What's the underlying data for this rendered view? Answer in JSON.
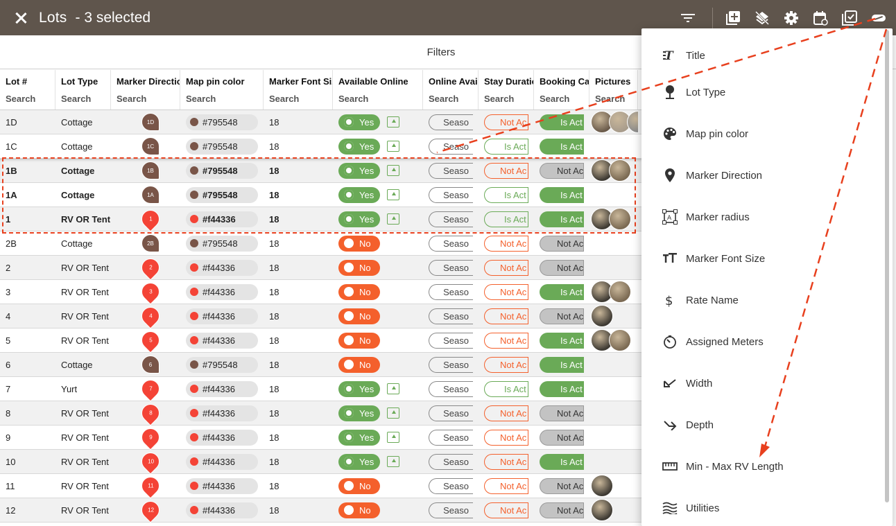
{
  "header": {
    "title": "Lots",
    "selection": "- 3 selected"
  },
  "filters": {
    "label": "Filters"
  },
  "columns": [
    {
      "label": "Lot #",
      "search": "Search"
    },
    {
      "label": "Lot Type",
      "search": "Search"
    },
    {
      "label": "Marker Direction",
      "search": "Search"
    },
    {
      "label": "Map pin color",
      "search": "Search"
    },
    {
      "label": "Marker Font Size",
      "search": "Search"
    },
    {
      "label": "Available Online",
      "search": "Search"
    },
    {
      "label": "Online Availability",
      "search": "Search"
    },
    {
      "label": "Stay Duration",
      "search": "Search"
    },
    {
      "label": "Booking Calendar",
      "search": "Search"
    },
    {
      "label": "Pictures",
      "search": "Search"
    }
  ],
  "labels": {
    "yes": "Yes",
    "no": "No",
    "season": "Seaso",
    "not_active": "Not Ac",
    "is_active": "Is Act",
    "font_size": "18"
  },
  "rows": [
    {
      "lot": "1D",
      "type": "Cottage",
      "marker": "1D",
      "pin": "brown",
      "color": "#795548",
      "avail": "yes",
      "stay": "notact",
      "book": "isact",
      "pics": 3,
      "bold": false
    },
    {
      "lot": "1C",
      "type": "Cottage",
      "marker": "1C",
      "pin": "brown",
      "color": "#795548",
      "avail": "yes",
      "stay": "isact",
      "book": "isact",
      "pics": 0,
      "bold": false
    },
    {
      "lot": "1B",
      "type": "Cottage",
      "marker": "1B",
      "pin": "brown",
      "color": "#795548",
      "avail": "yes",
      "stay": "notact",
      "book": "notact",
      "pics": 2,
      "bold": true
    },
    {
      "lot": "1A",
      "type": "Cottage",
      "marker": "1A",
      "pin": "brown",
      "color": "#795548",
      "avail": "yes",
      "stay": "isact",
      "book": "isact",
      "pics": 0,
      "bold": true
    },
    {
      "lot": "1",
      "type": "RV OR Tent",
      "marker": "1",
      "pin": "red",
      "color": "#f44336",
      "avail": "yes",
      "stay": "isact",
      "book": "isact",
      "pics": 2,
      "bold": true
    },
    {
      "lot": "2B",
      "type": "Cottage",
      "marker": "2B",
      "pin": "brown",
      "color": "#795548",
      "avail": "no",
      "stay": "notact",
      "book": "notact",
      "pics": 0,
      "bold": false
    },
    {
      "lot": "2",
      "type": "RV OR Tent",
      "marker": "2",
      "pin": "red",
      "color": "#f44336",
      "avail": "no",
      "stay": "notact",
      "book": "notact",
      "pics": 0,
      "bold": false
    },
    {
      "lot": "3",
      "type": "RV OR Tent",
      "marker": "3",
      "pin": "red",
      "color": "#f44336",
      "avail": "no",
      "stay": "notact",
      "book": "isact",
      "pics": 2,
      "bold": false
    },
    {
      "lot": "4",
      "type": "RV OR Tent",
      "marker": "4",
      "pin": "red",
      "color": "#f44336",
      "avail": "no",
      "stay": "notact",
      "book": "notact",
      "pics": 1,
      "bold": false
    },
    {
      "lot": "5",
      "type": "RV OR Tent",
      "marker": "5",
      "pin": "red",
      "color": "#f44336",
      "avail": "no",
      "stay": "notact",
      "book": "isact",
      "pics": 2,
      "bold": false
    },
    {
      "lot": "6",
      "type": "Cottage",
      "marker": "6",
      "pin": "brown",
      "color": "#795548",
      "avail": "no",
      "stay": "notact",
      "book": "isact",
      "pics": 0,
      "bold": false
    },
    {
      "lot": "7",
      "type": "Yurt",
      "marker": "7",
      "pin": "red",
      "color": "#f44336",
      "avail": "yes",
      "stay": "isact",
      "book": "isact",
      "pics": 0,
      "bold": false
    },
    {
      "lot": "8",
      "type": "RV OR Tent",
      "marker": "8",
      "pin": "red",
      "color": "#f44336",
      "avail": "yes",
      "stay": "notact",
      "book": "notact",
      "pics": 0,
      "bold": false
    },
    {
      "lot": "9",
      "type": "RV OR Tent",
      "marker": "9",
      "pin": "red",
      "color": "#f44336",
      "avail": "yes",
      "stay": "notact",
      "book": "notact",
      "pics": 0,
      "bold": false
    },
    {
      "lot": "10",
      "type": "RV OR Tent",
      "marker": "10",
      "pin": "red",
      "color": "#f44336",
      "avail": "yes",
      "stay": "notact",
      "book": "isact",
      "pics": 0,
      "bold": false
    },
    {
      "lot": "11",
      "type": "RV OR Tent",
      "marker": "11",
      "pin": "red",
      "color": "#f44336",
      "avail": "no",
      "stay": "notact",
      "book": "notact",
      "pics": 1,
      "bold": false
    },
    {
      "lot": "12",
      "type": "RV OR Tent",
      "marker": "12",
      "pin": "red",
      "color": "#f44336",
      "avail": "no",
      "stay": "notact",
      "book": "notact",
      "pics": 1,
      "bold": false
    }
  ],
  "menu": {
    "items": [
      {
        "label": "Title",
        "icon": "title-icon"
      },
      {
        "label": "Lot Type",
        "icon": "lot-type-icon"
      },
      {
        "label": "Map pin color",
        "icon": "palette-icon"
      },
      {
        "label": "Marker Direction",
        "icon": "location-pin-icon"
      },
      {
        "label": "Marker radius",
        "icon": "radius-icon"
      },
      {
        "label": "Marker Font Size",
        "icon": "font-size-icon"
      },
      {
        "label": "Rate Name",
        "icon": "dollar-icon"
      },
      {
        "label": "Assigned Meters",
        "icon": "meter-icon"
      },
      {
        "label": "Width",
        "icon": "width-icon"
      },
      {
        "label": "Depth",
        "icon": "depth-icon"
      },
      {
        "label": "Min - Max RV Length",
        "icon": "ruler-icon"
      },
      {
        "label": "Utilities",
        "icon": "utilities-icon"
      }
    ]
  },
  "colors": {
    "brand_bar": "#5f554c",
    "green": "#6aaa57",
    "orange": "#f4602c",
    "annotation": "#e8401e"
  }
}
